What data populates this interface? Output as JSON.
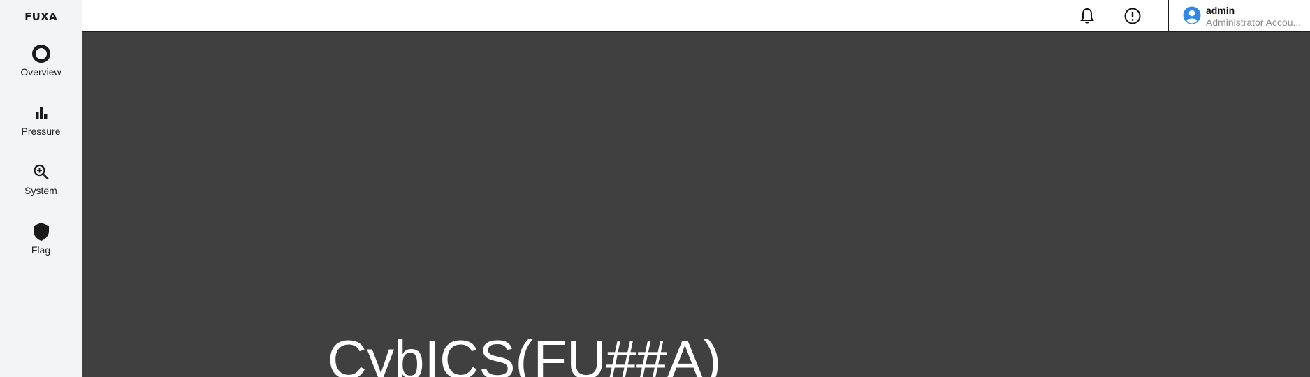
{
  "app": {
    "brand": "FUXA"
  },
  "sidebar": {
    "items": [
      {
        "label": "Overview",
        "icon": "ring-icon"
      },
      {
        "label": "Pressure",
        "icon": "bar-chart-icon"
      },
      {
        "label": "System",
        "icon": "zoom-in-icon"
      },
      {
        "label": "Flag",
        "icon": "shield-icon"
      }
    ]
  },
  "header": {
    "icons": [
      "bell-icon",
      "alert-circle-icon"
    ],
    "user": {
      "name": "admin",
      "role": "Administrator Accou...",
      "avatar_icon": "account-circle-icon",
      "avatar_color": "#2f8ae5"
    }
  },
  "main": {
    "title": "CybICS(FU##A)",
    "background": "#404040"
  }
}
